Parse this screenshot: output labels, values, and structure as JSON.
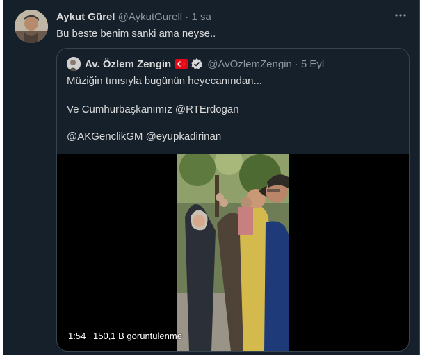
{
  "tweet": {
    "author_name": "Aykut Gürel",
    "handle": "@AykutGurell",
    "separator": "·",
    "time": "1 sa",
    "text": "Bu beste benim sanki ama neyse.."
  },
  "quoted": {
    "author_name": "Av. Özlem Zengin",
    "handle": "@AvOzlemZengin",
    "separator": "·",
    "date": "5 Eyl",
    "line1": "Müziğin tınısıyla bugünün heyecanından...",
    "line2": "Ve Cumhurbaşkanımız @RTErdogan",
    "line3": "@AKGenclikGM @eyupkadirinan",
    "video": {
      "duration": "1:54",
      "views": "150,1 B görüntülenme"
    }
  },
  "colors": {
    "background": "#15202b",
    "text": "#d9d9d9",
    "muted": "#8b98a5",
    "border": "#38444d",
    "verified": "#d9d9d9",
    "flag_red": "#e30a17"
  },
  "icons": [
    "more-icon",
    "flag-icon",
    "verified-icon"
  ]
}
